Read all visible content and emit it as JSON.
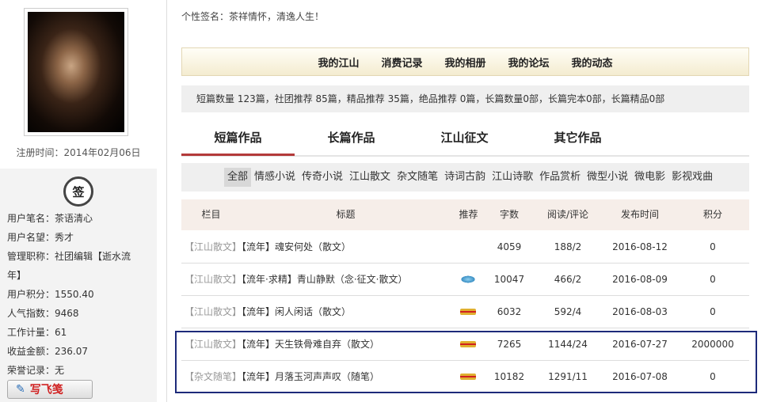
{
  "sidebar": {
    "reg_time": "注册时间：2014年02月06日",
    "badge": "签",
    "info": [
      "用户笔名：茶语清心",
      "用户名望：秀才",
      "管理职称：社团编辑【逝水流",
      "年】",
      "用户积分：1550.40",
      "人气指数：9468",
      "工作计量：61",
      "收益金额：236.07",
      "荣誉记录：无"
    ],
    "write_button": "写飞笺"
  },
  "signature": "个性签名：茶祥情怀，清逸人生！",
  "top_nav": [
    "我的江山",
    "消费记录",
    "我的相册",
    "我的论坛",
    "我的动态"
  ],
  "stats": "短篇数量 123篇，社团推荐 85篇，精品推荐 35篇，绝品推荐 0篇，长篇数量0部，长篇完本0部，长篇精品0部",
  "tabs": [
    "短篇作品",
    "长篇作品",
    "江山征文",
    "其它作品"
  ],
  "active_tab": 0,
  "categories": [
    "全部",
    "情感小说",
    "传奇小说",
    "江山散文",
    "杂文随笔",
    "诗词古韵",
    "江山诗歌",
    "作品赏析",
    "微型小说",
    "微电影",
    "影视戏曲"
  ],
  "table": {
    "headers": [
      "栏目",
      "标题",
      "推荐",
      "字数",
      "阅读/评论",
      "发布时间",
      "积分"
    ],
    "rows": [
      {
        "column": "【江山散文】",
        "title": "【流年】魂安何处（散文）",
        "rec": "",
        "words": "4059",
        "reads": "188/2",
        "date": "2016-08-12",
        "score": "0"
      },
      {
        "column": "【江山散文】",
        "title": "【流年·求精】青山静默（念·征文·散文）",
        "rec": "blue",
        "words": "10047",
        "reads": "466/2",
        "date": "2016-08-09",
        "score": "0"
      },
      {
        "column": "【江山散文】",
        "title": "【流年】闲人闲话（散文）",
        "rec": "flag",
        "words": "6032",
        "reads": "592/4",
        "date": "2016-08-03",
        "score": "0"
      },
      {
        "column": "【江山散文】",
        "title": "【流年】天生铁骨难自弃（散文）",
        "rec": "flag",
        "words": "7265",
        "reads": "1144/24",
        "date": "2016-07-27",
        "score": "2000000"
      },
      {
        "column": "【杂文随笔】",
        "title": "【流年】月落玉河声声叹（随笔）",
        "rec": "flag",
        "words": "10182",
        "reads": "1291/11",
        "date": "2016-07-08",
        "score": "0"
      }
    ]
  },
  "colors": {
    "tab_active": "#b33a3a",
    "highlight_border": "#1d2a7a",
    "header_bg": "#f6eee9"
  }
}
